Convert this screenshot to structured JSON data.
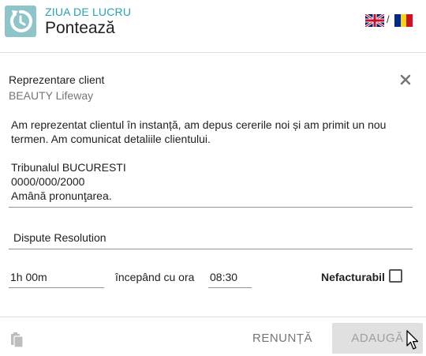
{
  "header": {
    "subtitle": "ZIUA DE LUCRU",
    "title": "Pontează",
    "language_separator": "/",
    "icons": [
      "clock-icon",
      "uk-flag-icon",
      "ro-flag-icon"
    ]
  },
  "entry": {
    "client_label": "Reprezentare client",
    "client_value": "BEAUTY Lifeway",
    "description": "Am reprezentat clientul în instanță, am depus cererile noi și am primit un nou termen. Am comunicat detaliile clientului.\n\nTribunalul BUCURESTI\n0000/000/2000\nAmână pronunţarea.",
    "project": "Dispute Resolution",
    "duration": "1h 00m",
    "start_label": "începând cu ora",
    "start_time": "08:30",
    "non_billable_label": "Nefacturabil",
    "non_billable_checked": false
  },
  "footer": {
    "cancel_label": "RENUNȚĂ",
    "add_label": "ADAUGĂ"
  },
  "colors": {
    "accent": "#2aa3b0",
    "app_icon_bg": "#8fc4c8",
    "add_button_bg": "#e0e0e0"
  }
}
